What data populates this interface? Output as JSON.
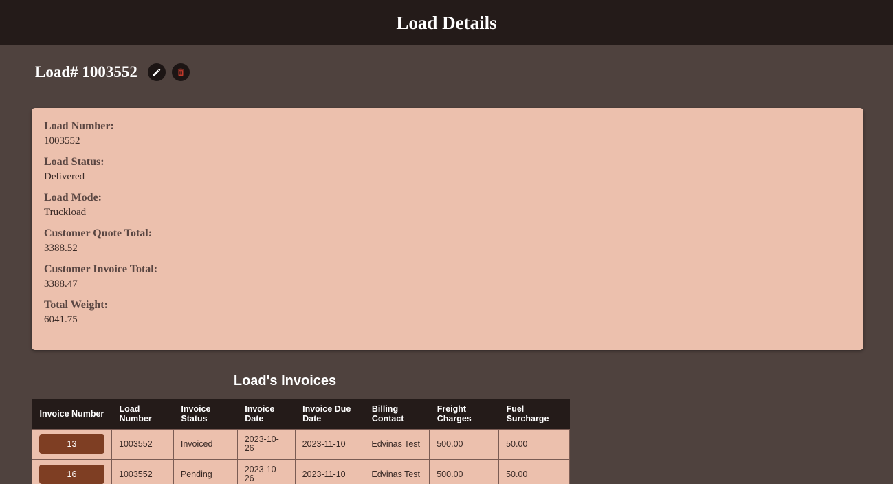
{
  "header": {
    "title": "Load Details"
  },
  "load": {
    "heading": "Load# 1003552",
    "edit_icon": "pencil-icon",
    "delete_icon": "trash-icon"
  },
  "details": [
    {
      "label": "Load Number:",
      "value": "1003552"
    },
    {
      "label": "Load Status:",
      "value": "Delivered"
    },
    {
      "label": "Load Mode:",
      "value": "Truckload"
    },
    {
      "label": "Customer Quote Total:",
      "value": "3388.52"
    },
    {
      "label": "Customer Invoice Total:",
      "value": "3388.47"
    },
    {
      "label": "Total Weight:",
      "value": "6041.75"
    }
  ],
  "invoices": {
    "title": "Load's Invoices",
    "columns": [
      "Invoice Number",
      "Load Number",
      "Invoice Status",
      "Invoice Date",
      "Invoice Due Date",
      "Billing Contact",
      "Freight Charges",
      "Fuel Surcharge"
    ],
    "rows": [
      [
        "13",
        "1003552",
        "Invoiced",
        "2023-10-26",
        "2023-11-10",
        "Edvinas Test",
        "500.00",
        "50.00"
      ],
      [
        "16",
        "1003552",
        "Pending",
        "2023-10-26",
        "2023-11-10",
        "Edvinas Test",
        "500.00",
        "50.00"
      ]
    ]
  },
  "colors": {
    "background": "#4f423e",
    "header_bg": "#241b19",
    "card_bg": "#ecc0ad",
    "invoice_button": "#7e3e23",
    "delete_icon": "#c0392b"
  }
}
